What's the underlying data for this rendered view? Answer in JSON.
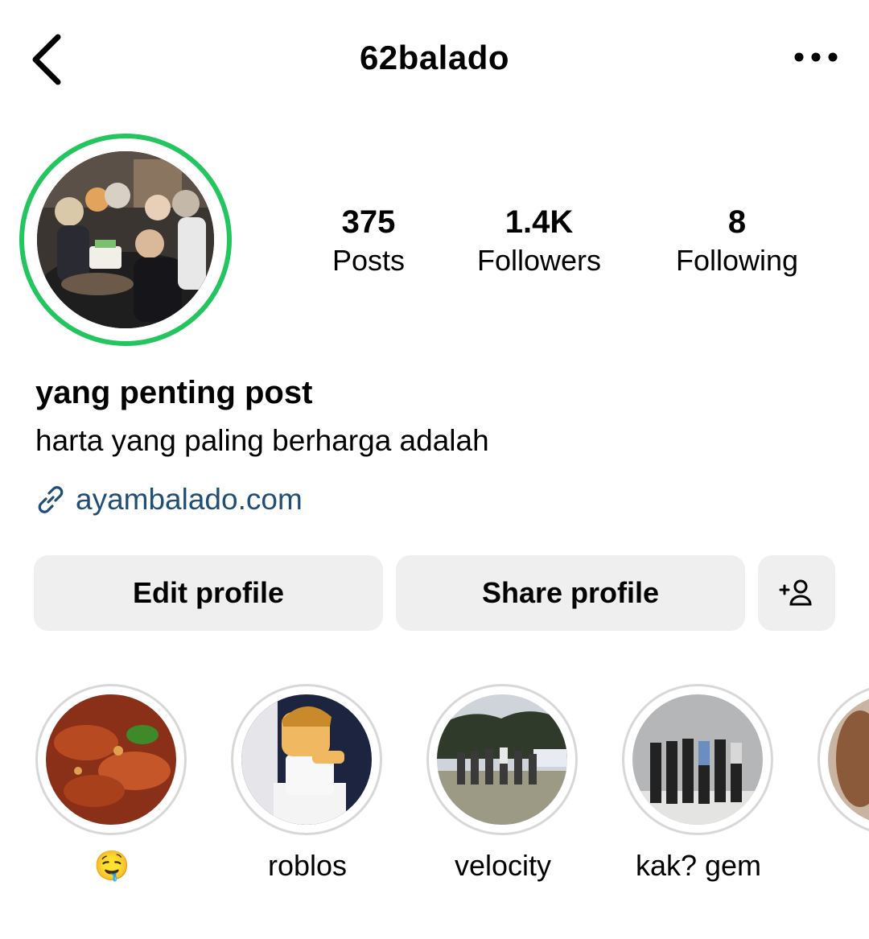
{
  "header": {
    "back_icon": "chevron-left-icon",
    "username": "62balado",
    "more_icon": "more-horizontal-icon"
  },
  "profile": {
    "ring_color": "#22c55e",
    "stats": [
      {
        "value": "375",
        "label": "Posts"
      },
      {
        "value": "1.4K",
        "label": "Followers"
      },
      {
        "value": "8",
        "label": "Following"
      }
    ],
    "display_name": "yang penting post",
    "bio": "harta yang paling berharga adalah",
    "link": {
      "icon": "link-icon",
      "text": "ayambalado.com",
      "color": "#1f4e79"
    }
  },
  "actions": {
    "edit_label": "Edit profile",
    "share_label": "Share profile",
    "add_icon": "add-person-icon"
  },
  "highlights": [
    {
      "label": "🤤"
    },
    {
      "label": "roblos"
    },
    {
      "label": "velocity"
    },
    {
      "label": "kak? gem"
    }
  ]
}
